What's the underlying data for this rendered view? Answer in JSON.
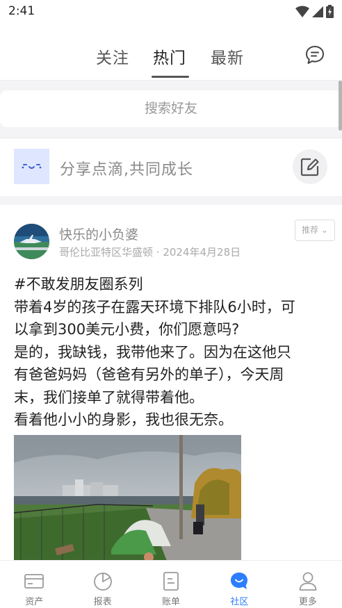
{
  "status_bar": {
    "time": "2:41"
  },
  "top_nav": {
    "tabs": [
      {
        "label": "关注"
      },
      {
        "label": "热门",
        "active": true
      },
      {
        "label": "最新"
      }
    ],
    "message_icon": "chat-bubble-icon"
  },
  "search": {
    "placeholder": "搜索好友"
  },
  "share": {
    "prompt": "分享点滴,共同成长",
    "edit_icon": "edit-icon"
  },
  "post": {
    "username": "快乐的小负婆",
    "location": "哥伦比亚特区华盛顿",
    "date": "2024年4月28日",
    "recommend_label": "推荐",
    "lines": [
      "#不敢发朋友圈系列",
      "带着4岁的孩子在露天环境下排队6小时，可",
      "以拿到300美元小费，你们愿意吗?",
      "是的，我缺钱，我带他来了。因为在这他只",
      "有爸爸妈妈（爸爸有另外的单子），今天周",
      "末，我们接单了就得带着他。",
      "看着他小小的身影，我也很无奈。"
    ]
  },
  "bottom_nav": {
    "active_color": "#2d7dff",
    "items": [
      {
        "label": "资产",
        "icon": "wallet-icon"
      },
      {
        "label": "报表",
        "icon": "pie-chart-icon"
      },
      {
        "label": "账单",
        "icon": "bill-icon"
      },
      {
        "label": "社区",
        "icon": "community-icon",
        "active": true
      },
      {
        "label": "更多",
        "icon": "profile-icon"
      }
    ]
  }
}
